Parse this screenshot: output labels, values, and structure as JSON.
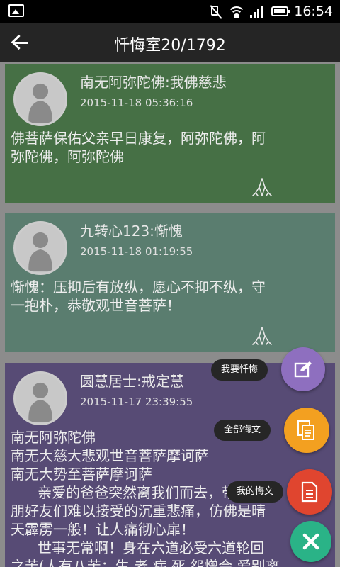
{
  "status_bar": {
    "time": "16:54"
  },
  "header": {
    "title": "忏悔室20/1792",
    "back_icon": "arrow-left-icon"
  },
  "posts": [
    {
      "name": "南无阿弥陀佛:我佛慈悲",
      "date": "2015-11-18 05:36:16",
      "content": "佛菩萨保佑父亲早日康复，阿弥陀佛，阿\n弥陀佛，阿弥陀佛",
      "bg_color": "#467045"
    },
    {
      "name": "九转心123:惭愧",
      "date": "2015-11-18 01:19:55",
      "content": "惭愧：压抑后有放纵，愿心不抑不纵，守\n一抱朴，恭敬观世音菩萨！",
      "bg_color": "#5a7d6f"
    },
    {
      "name": "圆慧居士:戒定慧",
      "date": "2015-11-17 23:39:55",
      "content": "南无阿弥陀佛\n南无大慈大悲观世音菩萨摩诃萨\n南无大势至菩萨摩诃萨\n      亲爱的爸爸突然离我们而去，带给亲\n朋好友们难以接受的沉重悲痛，仿佛是晴\n天霹雳一般！让人痛彻心扉！\n      世事无常啊！身在六道必受六道轮回\n之苦(人有八苦：生 老 病 死 怨憎会 爱别离",
      "bg_color": "#574b75"
    }
  ],
  "fab_menu": {
    "confess_label": "我要忏悔",
    "all_label": "全部悔文",
    "mine_label": "我的悔文",
    "colors": {
      "confess": "#8e6fbf",
      "all": "#f3a020",
      "mine": "#e0452f",
      "close": "#2ab387"
    }
  }
}
